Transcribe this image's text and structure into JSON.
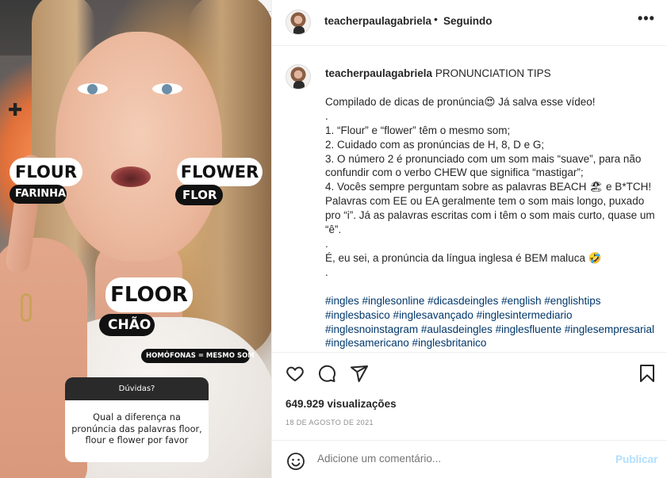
{
  "story": {
    "stickers": {
      "flour": "FLOUR",
      "farinha": "FARINHA",
      "flower": "FLOWER",
      "flor": "FLOR",
      "floor": "FLOOR",
      "chao": "CHÃO",
      "homofonas": "HOMÓFONAS = MESMO SOM"
    },
    "question_box": {
      "header": "Dúvidas?",
      "text": "Qual a diferença na pronúncia das palavras floor, flour e flower por favor"
    }
  },
  "post": {
    "username": "teacherpaulagabriela",
    "separator": "•",
    "follow_status": "Seguindo",
    "more": "•••",
    "caption": {
      "title": "PRONUNCIATION TIPS",
      "lines": [
        "Compilado de dicas de pronúncia😍 Já salva esse vídeo!",
        ".",
        "1. “Flour” e “flower” têm o mesmo som;",
        "2. Cuidado com as pronúncias de H, 8, D e G;",
        "3. O número 2 é pronunciado com um som mais “suave”, para não confundir com o verbo CHEW que significa “mastigar”;",
        "4. Vocês sempre perguntam sobre as palavras BEACH 🏖 e B*TCH! Palavras com EE ou EA geralmente tem o som mais longo, puxado pro “i”. Já as palavras escritas com i têm o som mais curto, quase um “ê”.",
        ".",
        "É, eu sei, a pronúncia da língua inglesa é BEM maluca 🤣",
        "."
      ],
      "hashtags": "#ingles #inglesonline #dicasdeingles #english #englishtips #inglesbasico #inglesavançado #inglesintermediario #inglesnoinstagram #aulasdeingles #inglesfluente #inglesempresarial #inglesamericano #inglesbritanico"
    },
    "views": "649.929 visualizações",
    "date": "18 DE AGOSTO DE 2021",
    "comment_placeholder": "Adicione um comentário...",
    "publish_label": "Publicar",
    "icons": [
      "heart-icon",
      "comment-icon",
      "share-icon",
      "save-icon",
      "emoji-icon",
      "more-icon"
    ],
    "colors": {
      "text": "#262626",
      "secondary": "#8e8e8e",
      "hashtag": "#00376b",
      "publish_disabled": "#b2dffc"
    }
  }
}
